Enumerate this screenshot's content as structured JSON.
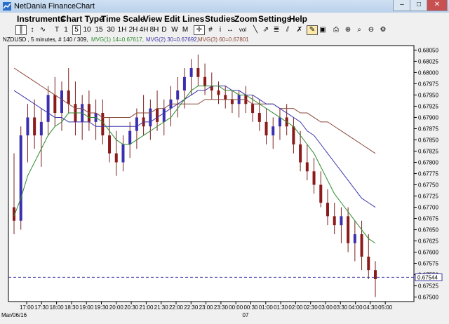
{
  "window": {
    "title": "NetDania FinanceChart",
    "min": "–",
    "max": "□",
    "close": "✕"
  },
  "menu": [
    "Instruments",
    "Chart Type",
    "Time Scale",
    "View",
    "Edit",
    "Lines",
    "Studies",
    "Zoom",
    "Settings",
    "Help"
  ],
  "toolbar": {
    "timeframes": [
      "T",
      "1",
      "5",
      "10",
      "15",
      "30",
      "1H",
      "2H",
      "4H",
      "8H",
      "D",
      "W",
      "M"
    ],
    "selected_timeframe": "5",
    "icons": [
      "bar-chart-icon",
      "candle-chart-icon",
      "line-chart-icon",
      "crosshair-icon",
      "grid-icon",
      "info-icon",
      "volume-icon",
      "line-draw-icon",
      "trend-icon",
      "fib-icon",
      "channel-icon",
      "cross-out-icon",
      "pencil-icon",
      "print-icon",
      "zoom-in-icon",
      "zoom-out-icon",
      "settings-icon"
    ],
    "volume_label": "vol"
  },
  "info": {
    "symbol": "NZDUSD , 5 minutes, # 140 / 309,",
    "mvg1": "MVG(1) 14=0.67617,",
    "mvg2": "MVG(2) 30=0.67692,",
    "mvg3": "MVG(3) 60=0.67801",
    "mvg1_color": "#2e8b2e",
    "mvg2_color": "#3a36a8",
    "mvg3_color": "#8b4a3a"
  },
  "chart_data": {
    "type": "candlestick",
    "symbol": "NZDUSD",
    "ylim": [
      0.6749,
      0.6806
    ],
    "yticks": [
      "0.68050",
      "0.68025",
      "0.68000",
      "0.67975",
      "0.67950",
      "0.67925",
      "0.67900",
      "0.67875",
      "0.67850",
      "0.67825",
      "0.67800",
      "0.67775",
      "0.67750",
      "0.67725",
      "0.67700",
      "0.67675",
      "0.67650",
      "0.67625",
      "0.67600",
      "0.67575",
      "0.67550",
      "0.67525",
      "0.67500"
    ],
    "xticks": [
      "17:00",
      "17:30",
      "18:00",
      "18:30",
      "19:00",
      "19:30",
      "20:00",
      "20:30",
      "21:00",
      "21:30",
      "22:00",
      "22:30",
      "23:00",
      "23:30",
      "00:00",
      "00:30",
      "01:00",
      "01:30",
      "02:00",
      "02:30",
      "03:00",
      "03:30",
      "04:00",
      "04:30",
      "05:00"
    ],
    "date_label_left": "Mar/06/16",
    "date_label_mid": "07",
    "last_price": "0.67544",
    "last_price_value": 0.67544,
    "candles": [
      [
        0.677,
        0.6782,
        0.6764,
        0.6767
      ],
      [
        0.6767,
        0.6788,
        0.6765,
        0.6786
      ],
      [
        0.6786,
        0.6793,
        0.678,
        0.679
      ],
      [
        0.679,
        0.6794,
        0.6783,
        0.6786
      ],
      [
        0.6786,
        0.6792,
        0.6779,
        0.6789
      ],
      [
        0.6789,
        0.6797,
        0.6786,
        0.6795
      ],
      [
        0.6795,
        0.6799,
        0.6788,
        0.6791
      ],
      [
        0.6791,
        0.6798,
        0.6787,
        0.6796
      ],
      [
        0.6796,
        0.6801,
        0.6791,
        0.6793
      ],
      [
        0.6793,
        0.6798,
        0.6786,
        0.6789
      ],
      [
        0.6789,
        0.6795,
        0.6785,
        0.6793
      ],
      [
        0.6793,
        0.6796,
        0.6787,
        0.6789
      ],
      [
        0.6789,
        0.6794,
        0.6785,
        0.6791
      ],
      [
        0.6791,
        0.6794,
        0.6784,
        0.6786
      ],
      [
        0.6786,
        0.679,
        0.678,
        0.6782
      ],
      [
        0.6782,
        0.6787,
        0.6777,
        0.678
      ],
      [
        0.678,
        0.6786,
        0.6778,
        0.6784
      ],
      [
        0.6784,
        0.6789,
        0.6781,
        0.6787
      ],
      [
        0.6787,
        0.6792,
        0.6783,
        0.679
      ],
      [
        0.679,
        0.6795,
        0.6786,
        0.6788
      ],
      [
        0.6788,
        0.6794,
        0.6785,
        0.6792
      ],
      [
        0.6792,
        0.6796,
        0.6787,
        0.6789
      ],
      [
        0.6789,
        0.6794,
        0.6786,
        0.6792
      ],
      [
        0.6792,
        0.6797,
        0.6788,
        0.6794
      ],
      [
        0.6794,
        0.6799,
        0.679,
        0.6796
      ],
      [
        0.6796,
        0.6801,
        0.6792,
        0.6799
      ],
      [
        0.6799,
        0.6803,
        0.6795,
        0.6801
      ],
      [
        0.6801,
        0.6804,
        0.6797,
        0.6799
      ],
      [
        0.6799,
        0.6802,
        0.6795,
        0.6797
      ],
      [
        0.6797,
        0.68,
        0.6794,
        0.6796
      ],
      [
        0.6796,
        0.6798,
        0.6793,
        0.6795
      ],
      [
        0.6795,
        0.6797,
        0.6792,
        0.6794
      ],
      [
        0.6794,
        0.6796,
        0.6791,
        0.6793
      ],
      [
        0.6793,
        0.6796,
        0.679,
        0.6795
      ],
      [
        0.6795,
        0.6797,
        0.6791,
        0.6793
      ],
      [
        0.6793,
        0.6795,
        0.6789,
        0.6791
      ],
      [
        0.6791,
        0.6794,
        0.6787,
        0.6789
      ],
      [
        0.6789,
        0.6792,
        0.6784,
        0.6786
      ],
      [
        0.6786,
        0.679,
        0.6783,
        0.6788
      ],
      [
        0.6788,
        0.6792,
        0.6785,
        0.679
      ],
      [
        0.679,
        0.6793,
        0.6786,
        0.6788
      ],
      [
        0.6788,
        0.679,
        0.6782,
        0.6784
      ],
      [
        0.6784,
        0.6787,
        0.6778,
        0.678
      ],
      [
        0.678,
        0.6784,
        0.6776,
        0.6778
      ],
      [
        0.6778,
        0.6781,
        0.6773,
        0.6775
      ],
      [
        0.6775,
        0.6778,
        0.677,
        0.6771
      ],
      [
        0.6771,
        0.6774,
        0.6766,
        0.6768
      ],
      [
        0.6768,
        0.6771,
        0.6764,
        0.6766
      ],
      [
        0.6766,
        0.677,
        0.6762,
        0.6768
      ],
      [
        0.6768,
        0.677,
        0.676,
        0.6762
      ],
      [
        0.6762,
        0.6767,
        0.6758,
        0.6764
      ],
      [
        0.6764,
        0.6767,
        0.6756,
        0.6759
      ],
      [
        0.6759,
        0.6764,
        0.6754,
        0.6756
      ],
      [
        0.6756,
        0.6758,
        0.675,
        0.6754
      ]
    ],
    "mvg1": [
      0.6768,
      0.6772,
      0.6777,
      0.678,
      0.6783,
      0.6786,
      0.6788,
      0.6789,
      0.6791,
      0.6791,
      0.6791,
      0.679,
      0.679,
      0.6789,
      0.6787,
      0.6785,
      0.6784,
      0.6784,
      0.6785,
      0.6786,
      0.6787,
      0.6788,
      0.6789,
      0.679,
      0.6792,
      0.6794,
      0.6796,
      0.6797,
      0.6797,
      0.6797,
      0.6797,
      0.6796,
      0.6796,
      0.6795,
      0.6795,
      0.6794,
      0.6793,
      0.6792,
      0.6791,
      0.679,
      0.6789,
      0.6788,
      0.6786,
      0.6784,
      0.6782,
      0.6779,
      0.6776,
      0.6773,
      0.6771,
      0.6769,
      0.6767,
      0.6765,
      0.6763,
      0.6762
    ],
    "mvg2": [
      0.6796,
      0.6795,
      0.6794,
      0.6793,
      0.6792,
      0.6791,
      0.679,
      0.679,
      0.6789,
      0.6789,
      0.6789,
      0.6789,
      0.6788,
      0.6788,
      0.6788,
      0.6788,
      0.6788,
      0.6788,
      0.6788,
      0.6789,
      0.6789,
      0.679,
      0.6791,
      0.6792,
      0.6793,
      0.6794,
      0.6795,
      0.6796,
      0.6796,
      0.6797,
      0.6797,
      0.6797,
      0.6796,
      0.6796,
      0.6795,
      0.6795,
      0.6794,
      0.6793,
      0.6793,
      0.6792,
      0.6791,
      0.679,
      0.6789,
      0.6787,
      0.6786,
      0.6784,
      0.6782,
      0.678,
      0.6778,
      0.6776,
      0.6774,
      0.6772,
      0.6771,
      0.677
    ],
    "mvg3": [
      0.6801,
      0.68,
      0.6799,
      0.6798,
      0.6797,
      0.6796,
      0.6795,
      0.6794,
      0.6793,
      0.6792,
      0.6792,
      0.6791,
      0.6791,
      0.679,
      0.679,
      0.679,
      0.679,
      0.679,
      0.6791,
      0.6791,
      0.6791,
      0.6792,
      0.6792,
      0.6793,
      0.6793,
      0.6793,
      0.6793,
      0.6793,
      0.6794,
      0.6794,
      0.6794,
      0.6794,
      0.6794,
      0.6794,
      0.6794,
      0.6793,
      0.6793,
      0.6793,
      0.6793,
      0.6792,
      0.6792,
      0.6792,
      0.6791,
      0.6791,
      0.679,
      0.6789,
      0.6789,
      0.6788,
      0.6787,
      0.6786,
      0.6785,
      0.6784,
      0.6783,
      0.6782
    ],
    "grid": false
  }
}
